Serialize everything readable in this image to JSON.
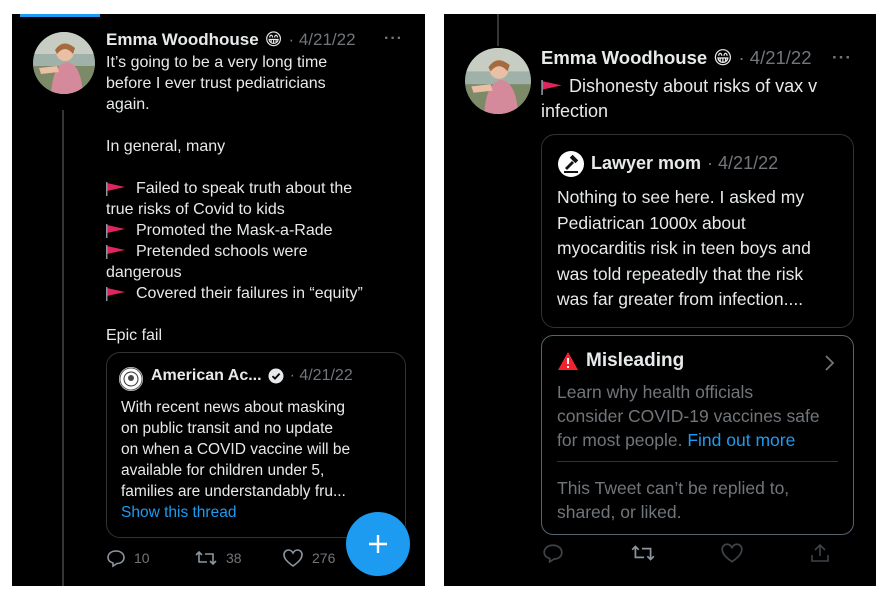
{
  "left": {
    "tweet": {
      "author": "Emma Woodhouse",
      "emoji": "😁",
      "date": "· 4/21/22",
      "more": "···",
      "intro": [
        "It’s going to be a very long time",
        "before I ever trust pediatricians",
        "again."
      ],
      "general": "In general, many",
      "points": [
        {
          "flag": true,
          "text": "Failed to speak truth about the"
        },
        {
          "flag": false,
          "text": "true risks of Covid to kids"
        },
        {
          "flag": true,
          "text": "Promoted the Mask-a-Rade"
        },
        {
          "flag": true,
          "text": "Pretended schools were"
        },
        {
          "flag": false,
          "text": "dangerous"
        },
        {
          "flag": true,
          "text": "Covered their failures in “equity”"
        }
      ],
      "closing": "Epic fail"
    },
    "quote": {
      "author": "American Ac...",
      "date": "· 4/21/22",
      "lines": [
        "With recent news about masking",
        "on public transit and no update",
        "on when a COVID vaccine will be",
        "available for children under 5,",
        "families are understandably fru..."
      ],
      "show_thread": "Show this thread"
    },
    "actions": {
      "replies": "10",
      "retweets": "38",
      "likes": "276"
    },
    "fab_icon": "plus-icon"
  },
  "right": {
    "tweet": {
      "author": "Emma Woodhouse",
      "emoji": "😁",
      "date": "· 4/21/22",
      "more": "···",
      "lines": [
        "Dishonesty about risks of vax v",
        "infection"
      ]
    },
    "quote": {
      "author": "Lawyer mom",
      "date": "· 4/21/22",
      "lines": [
        "Nothing to see here. I asked my",
        "Pediatrican 1000x about",
        "myocarditis risk in teen boys and",
        "was told repeatedly that the risk",
        "was far greater from infection...."
      ]
    },
    "misleading": {
      "title": "Misleading",
      "body": [
        "Learn why health officials",
        "consider COVID-19 vaccines safe",
        "for most people."
      ],
      "link": "Find out more",
      "footer": [
        "This Tweet can’t be replied to,",
        "shared, or liked."
      ]
    }
  },
  "colors": {
    "accent": "#1d9bf0",
    "flag": "#e0245e",
    "warning": "#f4212e",
    "muted": "#71767b"
  }
}
